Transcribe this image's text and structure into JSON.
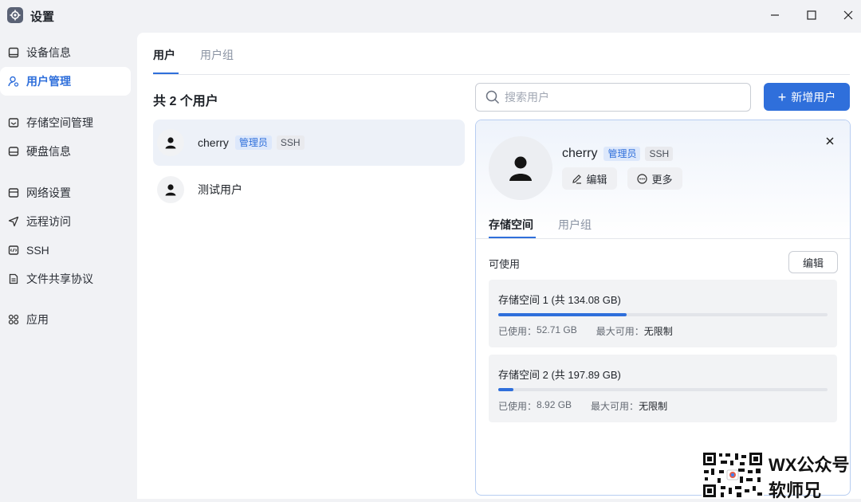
{
  "window": {
    "title": "设置",
    "controls": [
      "minimize",
      "maximize",
      "close"
    ]
  },
  "sidebar": {
    "items": [
      {
        "label": "设备信息",
        "icon": "monitor-icon",
        "active": false
      },
      {
        "label": "用户管理",
        "icon": "user-icon",
        "active": true
      },
      {
        "label": "存储空间管理",
        "icon": "storage-icon",
        "active": false
      },
      {
        "label": "硬盘信息",
        "icon": "disk-icon",
        "active": false
      },
      {
        "label": "网络设置",
        "icon": "network-icon",
        "active": false
      },
      {
        "label": "远程访问",
        "icon": "send-icon",
        "active": false
      },
      {
        "label": "SSH",
        "icon": "terminal-icon",
        "active": false
      },
      {
        "label": "文件共享协议",
        "icon": "document-icon",
        "active": false
      },
      {
        "label": "应用",
        "icon": "apps-icon",
        "active": false
      }
    ]
  },
  "main": {
    "tabs": [
      {
        "label": "用户",
        "active": true
      },
      {
        "label": "用户组",
        "active": false
      }
    ],
    "count_label": "共 2 个用户",
    "search": {
      "placeholder": "搜索用户"
    },
    "add_button": {
      "label": "新增用户"
    },
    "users": [
      {
        "name": "cherry",
        "badges": [
          "管理员",
          "SSH"
        ],
        "selected": true
      },
      {
        "name": "测试用户",
        "badges": [],
        "selected": false
      }
    ]
  },
  "detail": {
    "name": "cherry",
    "badges": {
      "admin": "管理员",
      "ssh": "SSH"
    },
    "edit_label": "编辑",
    "more_label": "更多",
    "tabs": [
      {
        "label": "存储空间",
        "active": true
      },
      {
        "label": "用户组",
        "active": false
      }
    ],
    "available_label": "可使用",
    "edit_button": "编辑",
    "volumes": [
      {
        "title": "存储空间 1 (共 134.08 GB)",
        "used_label": "已使用：",
        "used": "52.71 GB",
        "max_label": "最大可用：",
        "max": "无限制",
        "usage_fraction": 0.39
      },
      {
        "title": "存储空间 2 (共 197.89 GB)",
        "used_label": "已使用：",
        "used": "8.92 GB",
        "max_label": "最大可用：",
        "max": "无限制",
        "usage_fraction": 0.045
      }
    ]
  },
  "watermark": {
    "line1": "WX公众号",
    "line2": "软师兄"
  },
  "colors": {
    "accent": "#2f6fdb",
    "badge_admin_bg": "#dde8fb",
    "sidebar_bg": "#f1f2f5"
  }
}
